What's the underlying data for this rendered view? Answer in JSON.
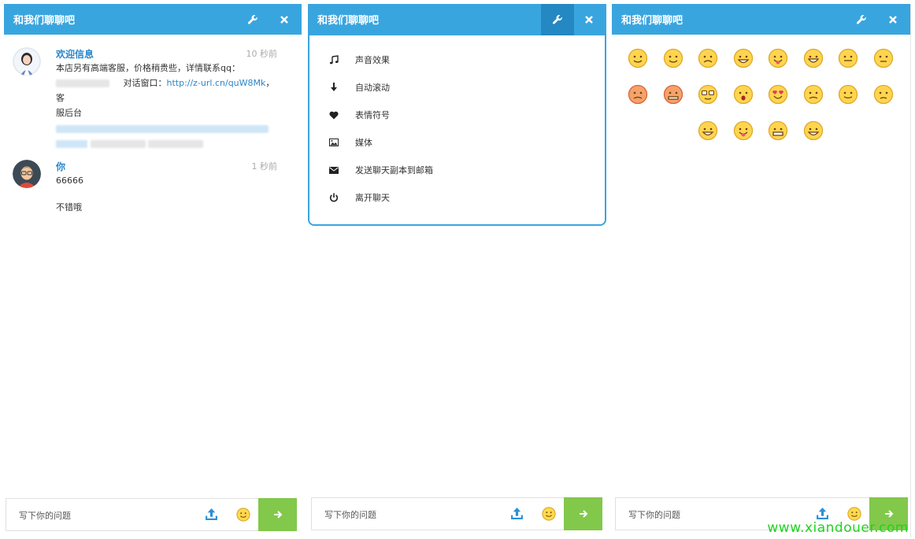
{
  "panels": [
    {
      "title": "和我们聊聊吧",
      "messages": [
        {
          "name": "欢迎信息",
          "time": "10 秒前",
          "line1": "本店另有高端客服，价格稍贵些，详情联系qq：",
          "line2_prefix": "对话窗口：",
          "link": "http://z-url.cn/quW8Mk",
          "line2_suffix": "，客",
          "line3": "服后台"
        },
        {
          "name": "你",
          "time": "1 秒前",
          "lines": [
            "66666",
            "不错哦"
          ]
        }
      ]
    },
    {
      "title": "和我们聊聊吧",
      "menu": [
        {
          "icon": "music-note-icon",
          "label": "声音效果"
        },
        {
          "icon": "arrow-down-icon",
          "label": "自动滚动"
        },
        {
          "icon": "heart-icon",
          "label": "表情符号"
        },
        {
          "icon": "image-icon",
          "label": "媒体"
        },
        {
          "icon": "envelope-icon",
          "label": "发送聊天副本到邮箱"
        },
        {
          "icon": "power-icon",
          "label": "离开聊天"
        }
      ]
    },
    {
      "title": "和我们聊聊吧",
      "emoji_count": 20
    }
  ],
  "input": {
    "placeholder": "写下你的问题"
  },
  "watermark": "www.xiandouer.com",
  "colors": {
    "header": "#39a5df",
    "send": "#82c84b",
    "link": "#2a86c9"
  }
}
